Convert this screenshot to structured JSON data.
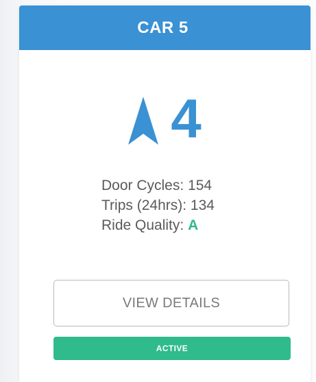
{
  "card": {
    "title": "CAR 5",
    "direction_icon": "up-arrow-icon",
    "floor": "4",
    "stats": {
      "door_cycles_label": "Door Cycles:",
      "door_cycles_value": "154",
      "trips_label": "Trips (24hrs):",
      "trips_value": "134",
      "ride_quality_label": "Ride Quality:",
      "ride_quality_value": "A"
    },
    "details_button_label": "VIEW DETAILS",
    "status_label": "ACTIVE"
  },
  "colors": {
    "header": "#3a91d3",
    "floor": "#3a91d3",
    "quality_grade": "#2fb98d",
    "status_badge": "#2fbb8b"
  }
}
